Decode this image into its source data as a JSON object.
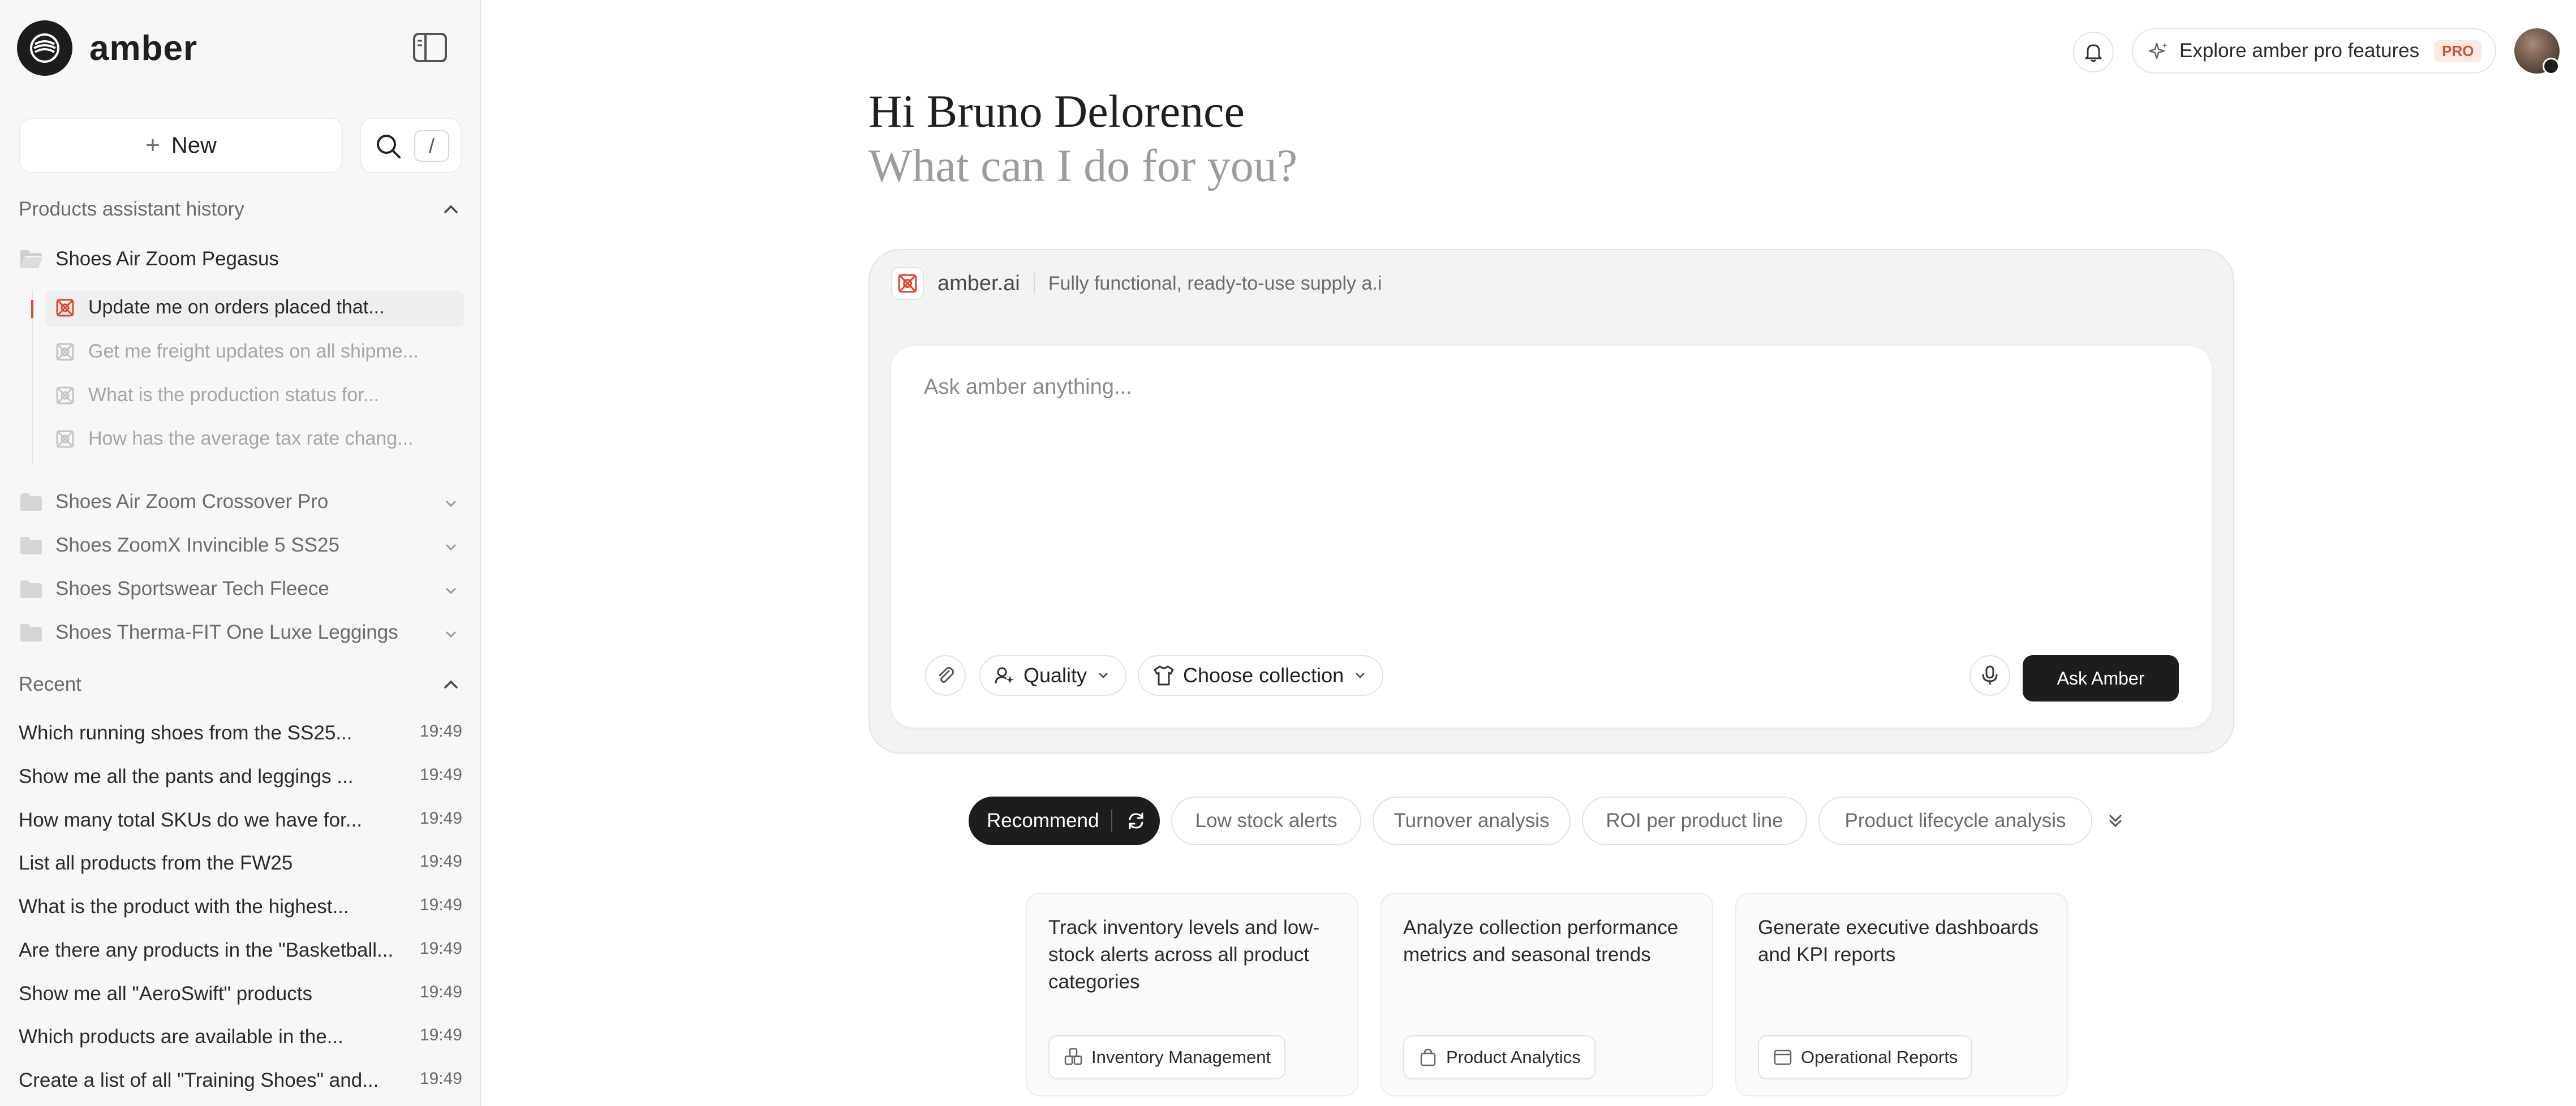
{
  "brand": {
    "name": "amber"
  },
  "sidebar": {
    "new_label": "New",
    "slash_key": "/",
    "history_title": "Products assistant history",
    "open_folder": {
      "label": "Shoes Air Zoom Pegasus",
      "items": [
        "Update me on orders placed that...",
        "Get me freight updates on all shipme...",
        "What is the production status for...",
        "How has the average tax rate chang..."
      ]
    },
    "folders": [
      "Shoes Air Zoom Crossover Pro",
      "Shoes ZoomX Invincible 5 SS25",
      "Shoes Sportswear Tech Fleece",
      "Shoes Therma-FIT One Luxe Leggings"
    ],
    "recent_title": "Recent",
    "recent": [
      {
        "label": "Which running shoes from the SS25...",
        "time": "19:49"
      },
      {
        "label": "Show me all the pants and leggings ...",
        "time": "19:49"
      },
      {
        "label": "How many total SKUs do we have for...",
        "time": "19:49"
      },
      {
        "label": "List all products from the FW25",
        "time": "19:49"
      },
      {
        "label": "What is the product with the highest...",
        "time": "19:49"
      },
      {
        "label": "Are there any products in the \"Basketball...",
        "time": "19:49"
      },
      {
        "label": "Show me all \"AeroSwift\" products",
        "time": "19:49"
      },
      {
        "label": "Which products are available in the...",
        "time": "19:49"
      },
      {
        "label": "Create a list of all \"Training Shoes\" and...",
        "time": "19:49"
      }
    ]
  },
  "topbar": {
    "pro_label": "Explore amber pro features",
    "pro_badge": "PRO"
  },
  "greeting": {
    "line1": "Hi Bruno Delorence",
    "line2": "What can I do for you?"
  },
  "composer": {
    "brand": "amber.ai",
    "tagline": "Fully functional, ready-to-use supply a.i",
    "placeholder": "Ask amber anything...",
    "quality_label": "Quality",
    "collection_label": "Choose collection",
    "ask_label": "Ask Amber"
  },
  "suggestions": {
    "chips": [
      "Recommend",
      "Low stock alerts",
      "Turnover analysis",
      "ROI per product line",
      "Product lifecycle analysis"
    ]
  },
  "cards": [
    {
      "text": "Track inventory levels and low-stock alerts across all product categories",
      "tag": "Inventory Management"
    },
    {
      "text": "Analyze collection performance metrics and seasonal trends",
      "tag": "Product Analytics"
    },
    {
      "text": "Generate executive dashboards and KPI reports",
      "tag": "Operational Reports"
    }
  ],
  "colors": {
    "accent": "#e0462e",
    "dark": "#1d1d1d",
    "sidebar_bg": "#f7f7f7"
  }
}
